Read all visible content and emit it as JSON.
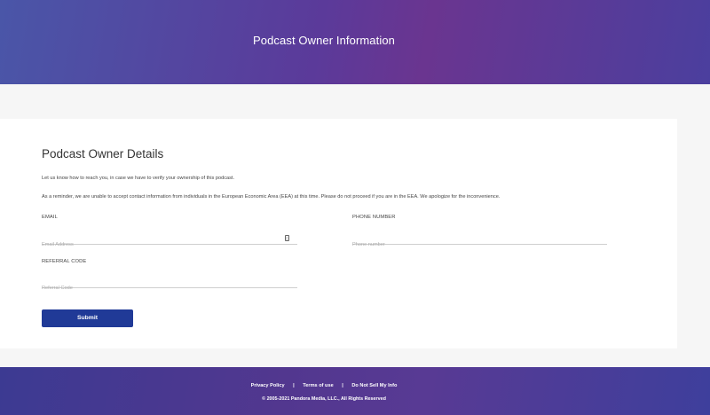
{
  "header": {
    "title": "Podcast Owner Information"
  },
  "card": {
    "title": "Podcast Owner Details",
    "intro": "Let us know how to reach you, in case we have to verify your ownership of this podcast.",
    "reminder": "As a reminder, we are unable to accept contact information from individuals in the European Economic Area (EEA) at this time. Please do not proceed if you are in the EEA. We apologize for the inconvenience."
  },
  "form": {
    "email": {
      "label": "EMAIL",
      "placeholder": "Email Address",
      "value": ""
    },
    "phone": {
      "label": "PHONE NUMBER",
      "placeholder": "Phone number",
      "value": ""
    },
    "referral": {
      "label": "REFERRAL CODE",
      "placeholder": "Referral Code",
      "value": ""
    },
    "submit_label": "Submit"
  },
  "footer": {
    "links": [
      "Privacy Policy",
      "Terms of use",
      "Do Not Sell My Info"
    ],
    "separator": "|",
    "copyright": "© 2005-2021 Pandora Media, LLC., All Rights Reserved"
  },
  "colors": {
    "header_gradient": [
      "#4a56a8",
      "#6a3590",
      "#4b3f9e"
    ],
    "submit": "#203a97",
    "footer_gradient": [
      "#3c3a92",
      "#583a94",
      "#3e3f9c"
    ]
  },
  "icons": {
    "email_field": "contact-card-icon"
  }
}
